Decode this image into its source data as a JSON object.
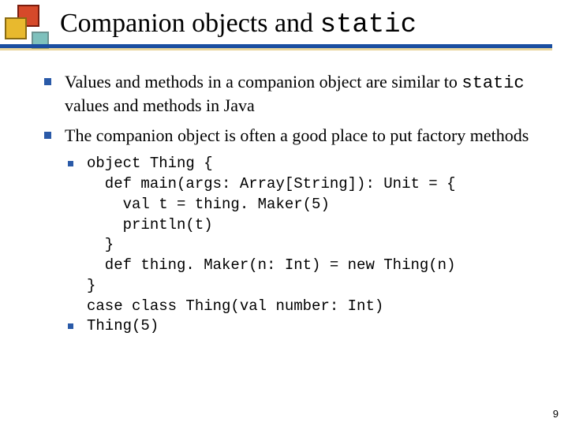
{
  "title": {
    "plain": "Companion objects and ",
    "mono": "static"
  },
  "bullets": [
    {
      "parts": [
        {
          "text": "Values and methods in a companion object are similar to ",
          "mono": false
        },
        {
          "text": "static",
          "mono": true
        },
        {
          "text": " values and methods in Java",
          "mono": false
        }
      ]
    },
    {
      "parts": [
        {
          "text": "The companion object is often a good place to put factory methods",
          "mono": false
        }
      ]
    }
  ],
  "code": {
    "lines": [
      "object Thing {",
      "  def main(args: Array[String]): Unit = {",
      "    val t = thing. Maker(5)",
      "    println(t)",
      "  }",
      "  def thing. Maker(n: Int) = new Thing(n)",
      "}",
      "case class Thing(val number: Int)"
    ],
    "result": "Thing(5)"
  },
  "page_number": "9"
}
